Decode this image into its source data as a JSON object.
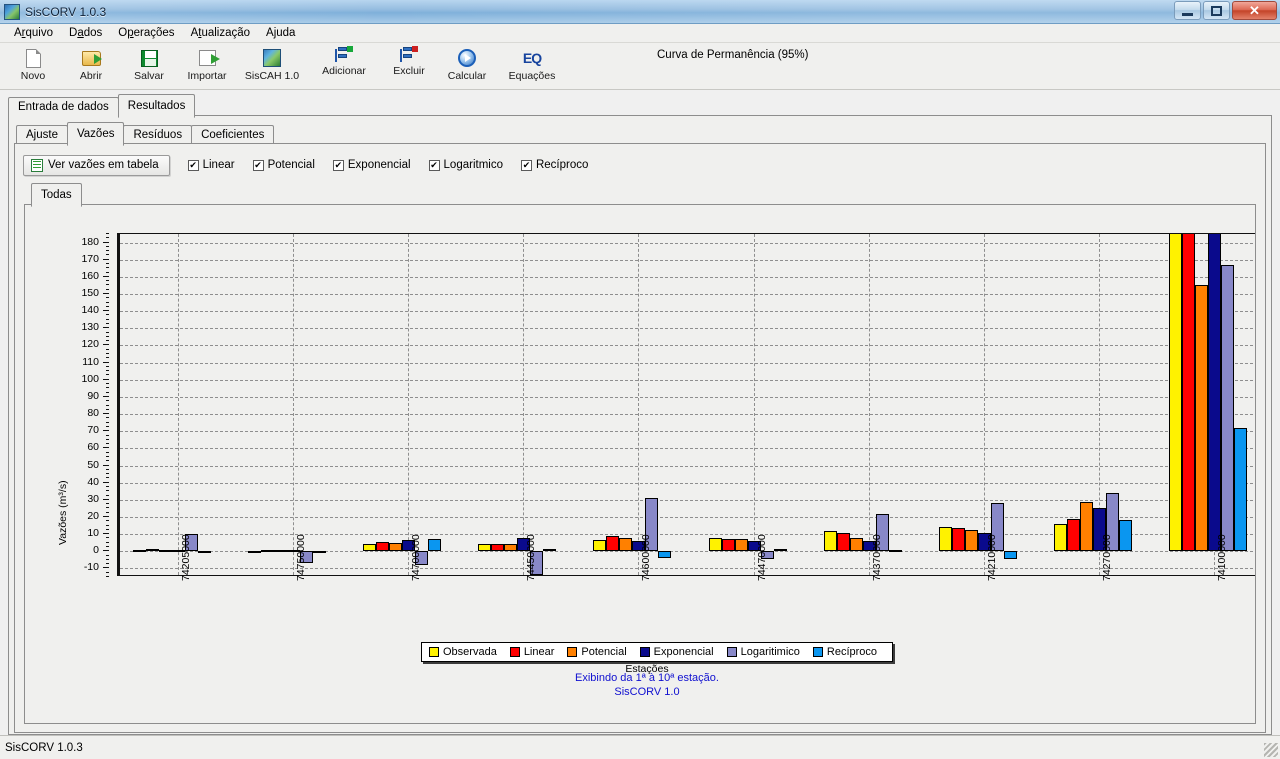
{
  "window": {
    "title": "SisCORV 1.0.3",
    "icon": "app-icon",
    "minimize": "—",
    "maximize": "❑",
    "close": "✕"
  },
  "menubar": {
    "items": [
      {
        "label": "Arquivo"
      },
      {
        "label": "Dados"
      },
      {
        "label": "Operações"
      },
      {
        "label": "Atualização"
      },
      {
        "label": "Ajuda"
      }
    ]
  },
  "toolbar": {
    "buttons": [
      {
        "label": "Novo",
        "icon": "new-document-icon"
      },
      {
        "label": "Abrir",
        "icon": "open-folder-icon"
      },
      {
        "label": "Salvar",
        "icon": "save-floppy-icon"
      },
      {
        "label": "Importar",
        "icon": "import-icon"
      },
      {
        "label": "SisCAH 1.0",
        "icon": "siscah-icon"
      },
      {
        "label": "Adicionar",
        "icon": "add-station-icon"
      },
      {
        "label": "Excluir",
        "icon": "delete-station-icon"
      },
      {
        "label": "Calcular",
        "icon": "calculate-play-icon"
      },
      {
        "label": "Equações",
        "icon": "equations-icon"
      }
    ],
    "context_title": "Curva de Permanência (95%)"
  },
  "outer_tabs": [
    {
      "label": "Entrada de dados",
      "active": false
    },
    {
      "label": "Resultados",
      "active": true
    }
  ],
  "inner_tabs": [
    {
      "label": "Ajuste",
      "active": false
    },
    {
      "label": "Vazões",
      "active": true
    },
    {
      "label": "Resíduos",
      "active": false
    },
    {
      "label": "Coeficientes",
      "active": false
    }
  ],
  "options": {
    "view_table_button": "Ver vazões em tabela",
    "view_table_icon": "table-icon",
    "checkboxes": [
      {
        "label": "Linear",
        "checked": true
      },
      {
        "label": "Potencial",
        "checked": true
      },
      {
        "label": "Exponencial",
        "checked": true
      },
      {
        "label": "Logaritmico",
        "checked": true
      },
      {
        "label": "Recíproco",
        "checked": true
      }
    ]
  },
  "chart_tabs": [
    {
      "label": "Todas",
      "active": true
    }
  ],
  "footer": {
    "line1": "Exibindo da 1ª à 10ª estação.",
    "line2": "SisCORV 1.0"
  },
  "statusbar": {
    "text": "SisCORV 1.0.3"
  },
  "chart_data": {
    "type": "bar",
    "title": "",
    "xlabel": "Estações",
    "ylabel": "Vazões (m³/s)",
    "ylim": [
      -15,
      185
    ],
    "yticks": [
      -10,
      0,
      10,
      20,
      30,
      40,
      50,
      60,
      70,
      80,
      90,
      100,
      110,
      120,
      130,
      140,
      150,
      160,
      170,
      180
    ],
    "grid": true,
    "legend_position": "bottom-center",
    "categories": [
      "74205000",
      "74750000",
      "74700000",
      "74450000",
      "74600000",
      "74470000",
      "74370000",
      "74210000",
      "74270000",
      "74100000"
    ],
    "series": [
      {
        "name": "Observada",
        "color": "#FFF200",
        "values": [
          0.5,
          0.3,
          4.0,
          4.5,
          6.5,
          7.5,
          12.0,
          14.0,
          16.0,
          200.0
        ]
      },
      {
        "name": "Linear",
        "color": "#FF0000",
        "values": [
          1.2,
          0.8,
          5.5,
          4.2,
          9.0,
          7.0,
          10.5,
          13.5,
          19.0,
          200.0
        ]
      },
      {
        "name": "Potencial",
        "color": "#FF8000",
        "values": [
          1.0,
          0.6,
          5.0,
          4.0,
          7.5,
          7.0,
          7.5,
          12.5,
          29.0,
          155.0
        ]
      },
      {
        "name": "Exponencial",
        "color": "#0A0A8C",
        "values": [
          0.8,
          0.5,
          6.5,
          7.5,
          6.0,
          6.0,
          6.0,
          10.5,
          25.0,
          200.0
        ]
      },
      {
        "name": "Logaritimico",
        "color": "#8888C8",
        "values": [
          10.0,
          -7.0,
          -8.0,
          -14.0,
          31.0,
          -4.5,
          22.0,
          28.0,
          34.0,
          167.0
        ]
      },
      {
        "name": "Reciproco",
        "color": "#0A96F0",
        "values": [
          0.2,
          0.2,
          7.0,
          1.5,
          -4.0,
          1.5,
          0.5,
          -4.5,
          18.0,
          72.0
        ]
      }
    ],
    "legend": [
      {
        "label": "Observada",
        "color": "#FFF200"
      },
      {
        "label": "Linear",
        "color": "#FF0000"
      },
      {
        "label": "Potencial",
        "color": "#FF8000"
      },
      {
        "label": "Exponencial",
        "color": "#0A0A8C"
      },
      {
        "label": "Logaritimico",
        "color": "#8888C8"
      },
      {
        "label": "Recíproco",
        "color": "#0A96F0"
      }
    ]
  }
}
